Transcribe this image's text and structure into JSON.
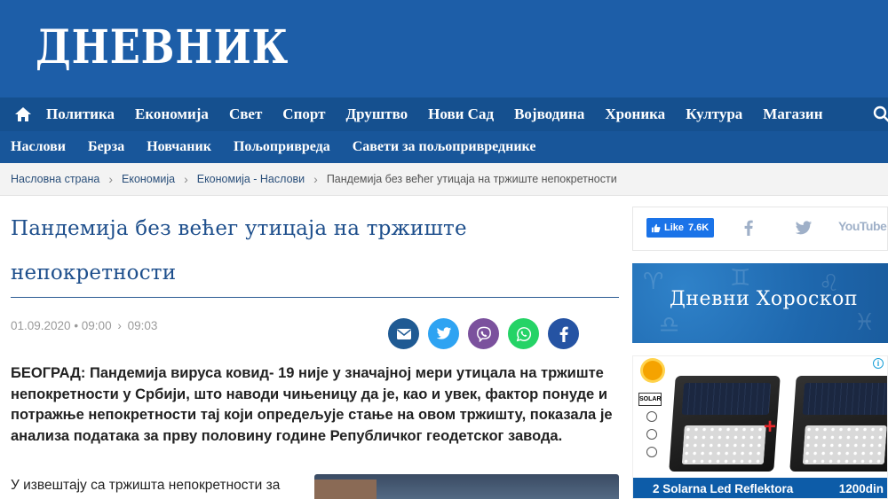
{
  "header": {
    "logo": "ДНЕВНИК",
    "brand_color": "#1d5ea8"
  },
  "main_nav": {
    "home_icon": "home-icon",
    "items": [
      "Политика",
      "Економија",
      "Свет",
      "Спорт",
      "Друштво",
      "Нови Сад",
      "Војводина",
      "Хроника",
      "Култура",
      "Магазин"
    ],
    "search_icon": "search-icon"
  },
  "sub_nav": {
    "items": [
      "Наслови",
      "Берза",
      "Новчаник",
      "Пољопривреда",
      "Савети за пољопривреднике"
    ]
  },
  "breadcrumb": {
    "items": [
      "Насловна страна",
      "Економија",
      "Економија - Наслови"
    ],
    "current": "Пандемија без већег утицаја на тржиште непокретности"
  },
  "article": {
    "title": "Пандемија без већег утицаја на тржиште непокретности",
    "date": "01.09.2020 • 09:00",
    "updated": "09:03",
    "share_buttons": [
      {
        "icon": "email-icon",
        "color": "#1f5a93"
      },
      {
        "icon": "twitter-icon",
        "color": "#2ea3f2"
      },
      {
        "icon": "viber-icon",
        "color": "#7b519d"
      },
      {
        "icon": "whatsapp-icon",
        "color": "#25d366"
      },
      {
        "icon": "facebook-icon",
        "color": "#2553a3"
      }
    ],
    "lead": "БЕОГРАД: Пандемија вируса ковид- 19 није у значајној мери утицала на тржиште непокретности у Србији, што наводи чињеницу да је, као и увек, фактор понуде и потражње непокретности тај који опредељује стање на овом тржишту, показала је анализа података за прву половину године Републичког геодетског завода.",
    "body": "У извештају са тржишта непокретности за прву шест месеци наводи се да је у"
  },
  "sidebar": {
    "social": {
      "like_label": "Like",
      "like_count": "7.6K",
      "youtube_label": "YouTube"
    },
    "horoscope": "Дневни Хороскоп",
    "ad": {
      "name": "2 Solarna Led Reflektora",
      "price": "1200din",
      "solar_tag": "SOLAR",
      "info_icon": "info-icon"
    }
  }
}
